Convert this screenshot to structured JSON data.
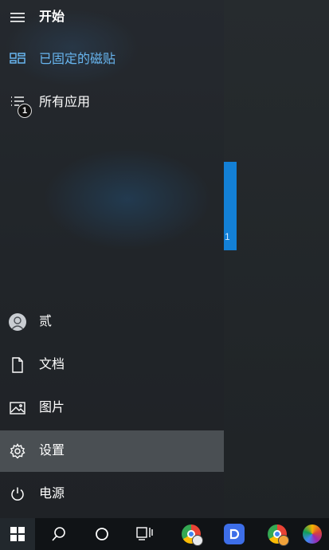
{
  "start_menu": {
    "header": {
      "label": "开始",
      "icon": "hamburger-icon"
    },
    "pinned": {
      "label": "已固定的磁贴",
      "icon": "tiles-icon",
      "accent_color": "#68b6f0"
    },
    "all_apps": {
      "label": "所有应用",
      "icon": "list-icon",
      "badge": "1"
    },
    "user": {
      "label": "贰",
      "icon": "user-icon"
    },
    "documents": {
      "label": "文档",
      "icon": "document-icon"
    },
    "pictures": {
      "label": "图片",
      "icon": "picture-icon"
    },
    "settings": {
      "label": "设置",
      "icon": "gear-icon",
      "highlighted": true
    },
    "power": {
      "label": "电源",
      "icon": "power-icon"
    }
  },
  "tile_fragment": "1",
  "taskbar": {
    "items": [
      {
        "name": "windows-start-icon"
      },
      {
        "name": "search-icon"
      },
      {
        "name": "cortana-icon"
      },
      {
        "name": "task-view-icon"
      },
      {
        "name": "chrome-profile-icon"
      },
      {
        "name": "app-d-icon"
      },
      {
        "name": "chrome-profile-2-icon"
      },
      {
        "name": "colorful-app-icon"
      }
    ]
  },
  "colors": {
    "accent": "#68b6f0",
    "tile_blue": "#1380d6",
    "highlight": "#5f6468"
  }
}
